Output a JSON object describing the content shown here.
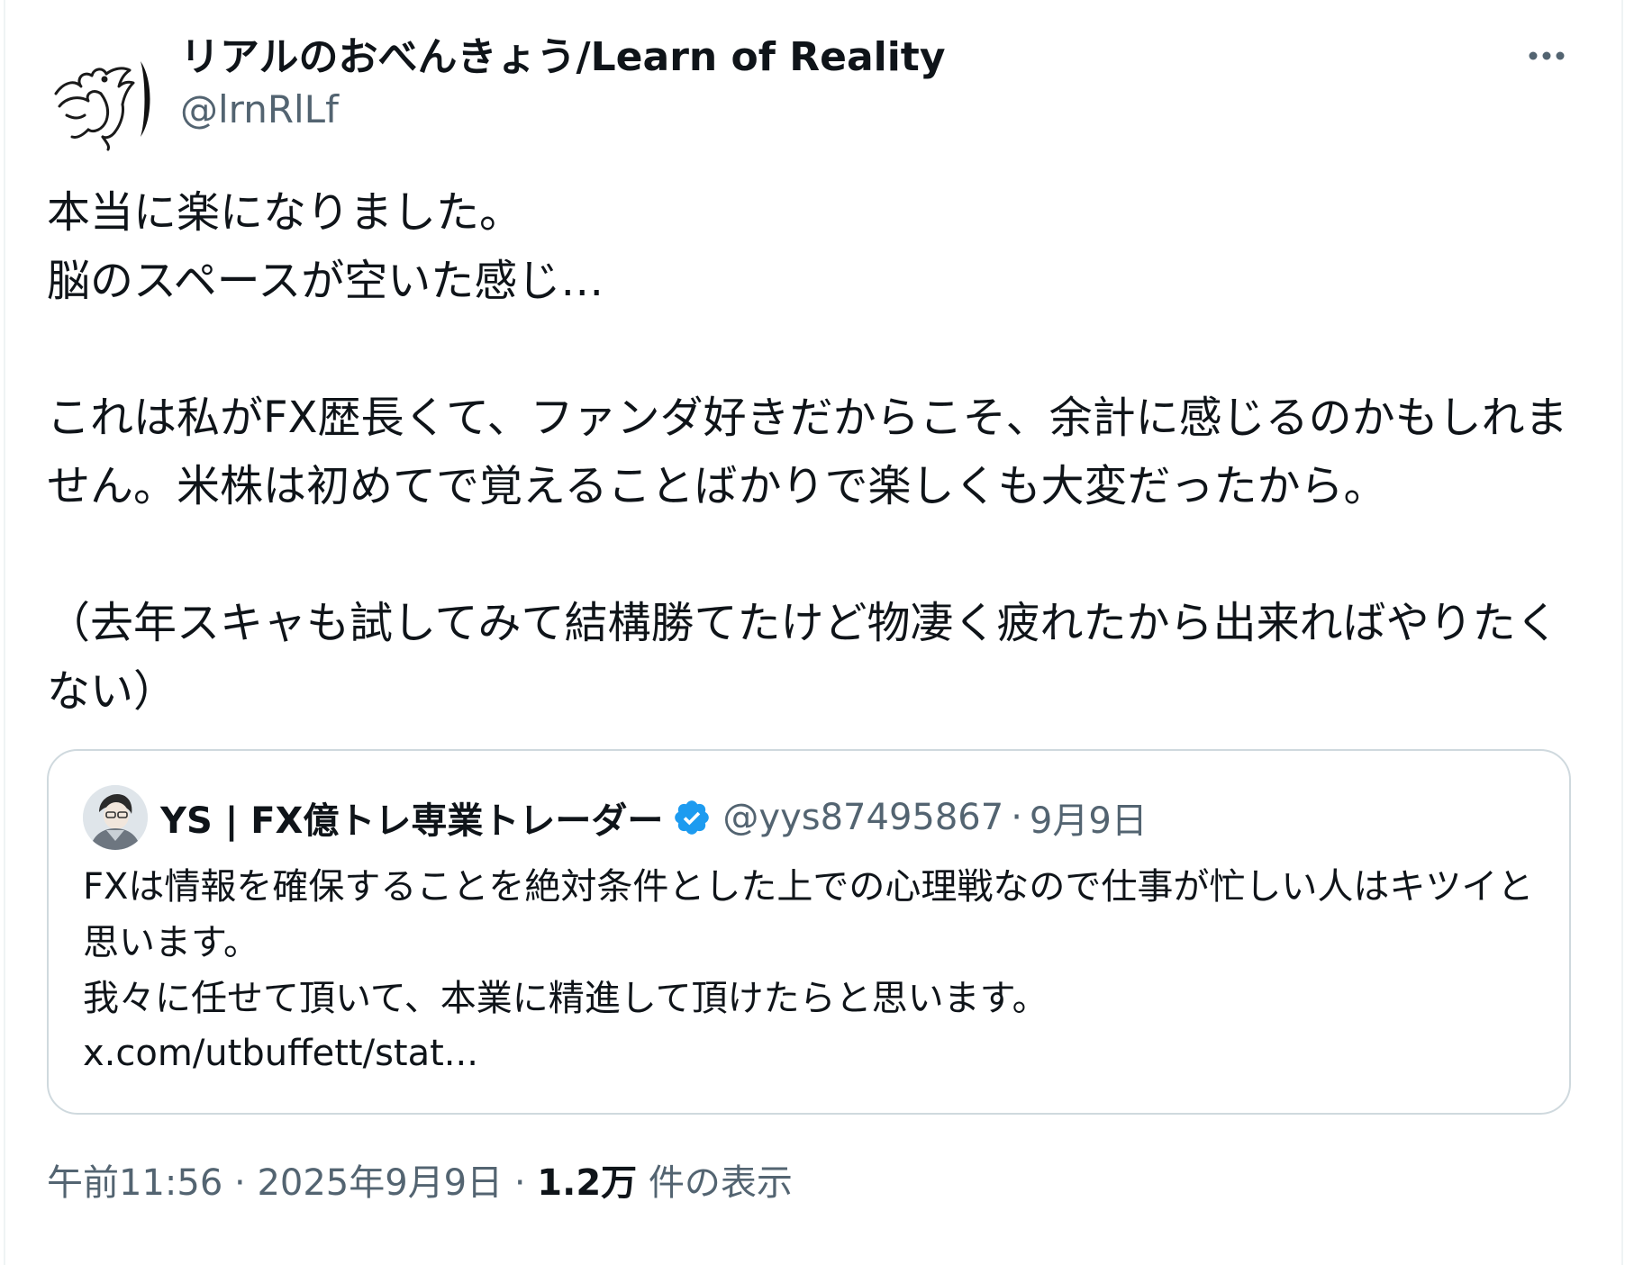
{
  "author": {
    "display_name": "リアルのおべんきょう/Learn of Reality",
    "handle": "@lrnRlLf",
    "avatar_icon": "phoenix-bird-icon"
  },
  "more_icon": "more-dots-icon",
  "tweet_text": "本当に楽になりました。\n脳のスペースが空いた感じ…\n\nこれは私がFX歴長くて、ファンダ好きだからこそ、余計に感じるのかもしれません。米株は初めてで覚えることばかりで楽しくも大変だったから。\n\n（去年スキャも試してみて結構勝てたけど物凄く疲れたから出来ればやりたくない）",
  "quote": {
    "display_name": "YS | FX億トレ専業トレーダー",
    "verified_icon": "verified-badge-icon",
    "handle": "@yys87495867",
    "separator": "·",
    "date": "9月9日",
    "text": "FXは情報を確保することを絶対条件とした上での心理戦なので仕事が忙しい人はキツイと思います。\n我々に任せて頂いて、本業に精進して頂けたらと思います。",
    "link": "x.com/utbuffett/stat..."
  },
  "meta": {
    "time": "午前11:56",
    "separator": "·",
    "date": "2025年9月9日",
    "views_count": "1.2万",
    "views_label": " 件の表示"
  },
  "colors": {
    "text_primary": "#0f1419",
    "text_secondary": "#536471",
    "border": "#cfd9de",
    "verified": "#1d9bf0"
  }
}
